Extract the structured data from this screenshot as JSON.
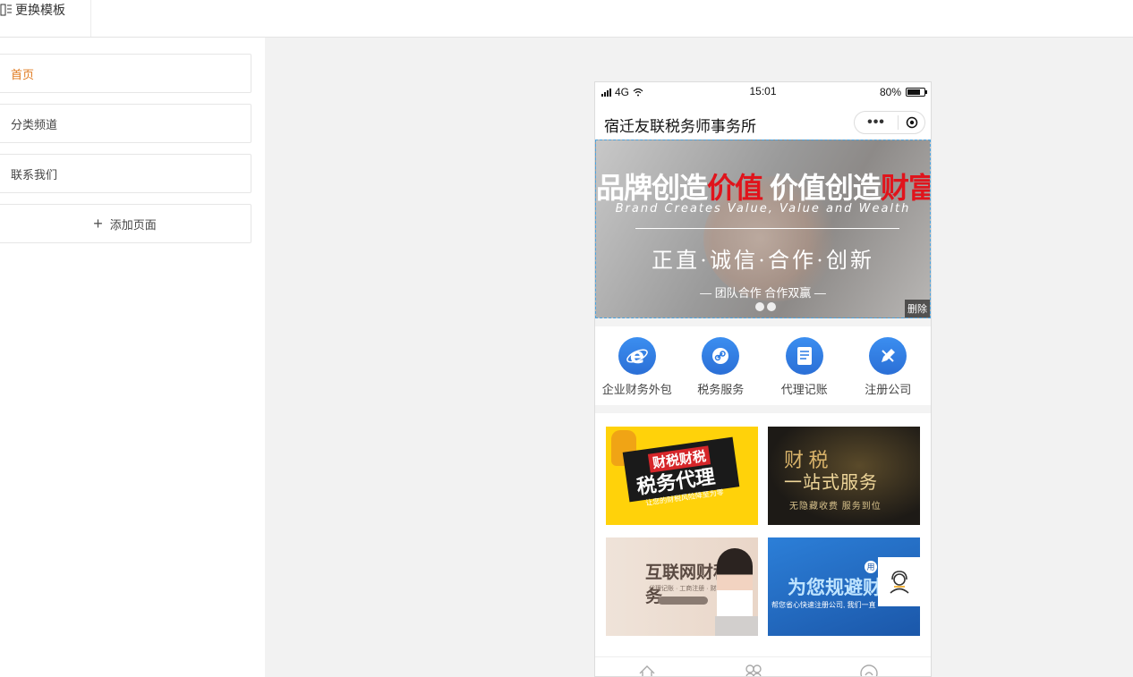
{
  "topbar": {
    "template_button": "更换模板"
  },
  "pages": {
    "items": [
      {
        "label": "首页",
        "active": true
      },
      {
        "label": "分类频道",
        "active": false
      },
      {
        "label": "联系我们",
        "active": false
      }
    ],
    "add_label": "添加页面"
  },
  "phone": {
    "status": {
      "network": "4G",
      "time": "15:01",
      "battery": "80%",
      "battery_level": 0.8
    },
    "nav_title": "宿迁友联税务师事务所",
    "capsule_more": "•••",
    "banner": {
      "headline_a": "品牌创造",
      "headline_b": "价值",
      "headline_c": "价值创造",
      "headline_d": "财富",
      "english": "Brand Creates Value, Value and Wealth",
      "values": "正直·诚信·合作·创新",
      "slogan": "— 团队合作  合作双赢 —",
      "delete_label": "删除",
      "slide_count": 2
    },
    "icon_nav": [
      {
        "label": "企业财务外包",
        "icon": "ie-icon"
      },
      {
        "label": "税务服务",
        "icon": "link-icon"
      },
      {
        "label": "代理记账",
        "icon": "ledger-icon"
      },
      {
        "label": "注册公司",
        "icon": "pencil-icon"
      }
    ],
    "tiles": {
      "t1": {
        "tag": "财税财税",
        "title": "税务代理",
        "sub": "让您的财税风险降至为零"
      },
      "t2": {
        "title_a": "财 税",
        "title_b": "一站式服务",
        "sub": "无隐藏收费 服务到位"
      },
      "t3": {
        "title": "互联网财税服务",
        "sub": "代理记账 · 工商注册 · 财税咨询"
      },
      "t4": {
        "badge": "用",
        "title": "为您规避财务",
        "sub": "帮您省心快速注册公司, 我们一直"
      }
    }
  },
  "colors": {
    "active": "#e07a1f",
    "icon_blue": "#2b7be4",
    "banner_red": "#e0141c"
  }
}
